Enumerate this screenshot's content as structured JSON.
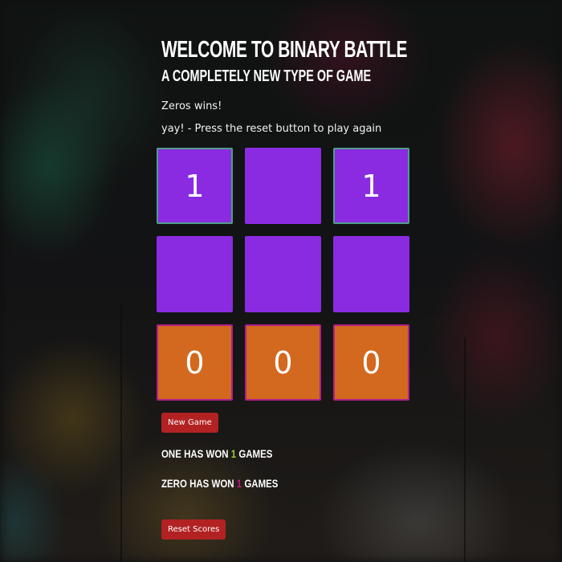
{
  "header": {
    "title": "Welcome to Binary Battle",
    "subtitle": "A completely new type of game"
  },
  "status": {
    "winner_text": "Zeros wins!",
    "hint_text": "yay! - Press the reset button to play again"
  },
  "board": {
    "cells": [
      "1",
      "",
      "1",
      "",
      "",
      "",
      "0",
      "0",
      "0"
    ]
  },
  "buttons": {
    "new_game": "New Game",
    "reset_scores": "Reset Scores"
  },
  "scores": {
    "one_prefix": "One has won",
    "one_count": "1",
    "one_suffix": "games",
    "zero_prefix": "Zero has won",
    "zero_count": "1",
    "zero_suffix": "games"
  },
  "colors": {
    "cell_one": "#8a2be2",
    "cell_zero": "#d2691e",
    "button": "#b22222",
    "one_count": "#9acd32",
    "zero_count": "#c71585"
  }
}
